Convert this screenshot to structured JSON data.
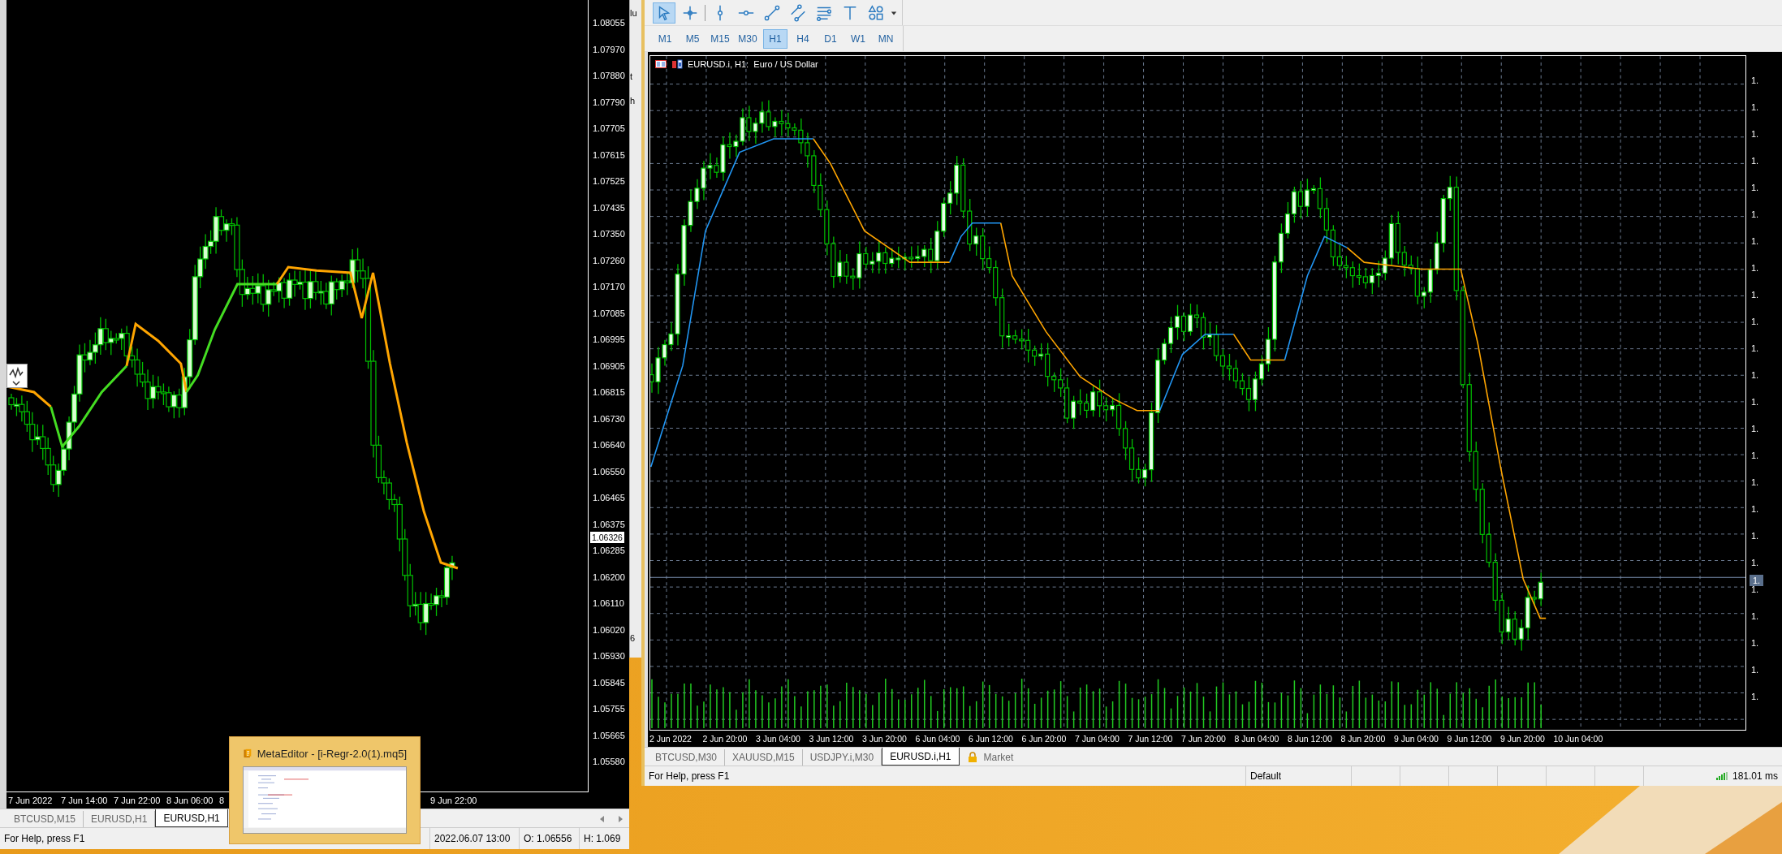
{
  "left_window": {
    "price_axis": [
      "1.08055",
      "1.07970",
      "1.07880",
      "1.07790",
      "1.07705",
      "1.07615",
      "1.07525",
      "1.07435",
      "1.07350",
      "1.07260",
      "1.07170",
      "1.07085",
      "1.06995",
      "1.06905",
      "1.06815",
      "1.06730",
      "1.06640",
      "1.06550",
      "1.06465",
      "1.06375",
      "1.06285",
      "1.06200",
      "1.06110",
      "1.06020",
      "1.05930",
      "1.05845",
      "1.05755",
      "1.05665",
      "1.05580"
    ],
    "current_price": "1.06326",
    "time_axis": [
      "7 Jun 2022",
      "7 Jun 14:00",
      "7 Jun 22:00",
      "8 Jun 06:00",
      "8",
      "9 Jun 22:00"
    ],
    "tabs": [
      {
        "label": "BTCUSD,M15",
        "selected": false
      },
      {
        "label": "EURUSD,H1",
        "selected": false
      },
      {
        "label": "EURUSD,H1",
        "selected": true
      }
    ],
    "status_bar": [
      "For Help, press F1",
      "2022.06.07 13:00",
      "O: 1.06556",
      "H: 1.069"
    ]
  },
  "background_window": {
    "fragments": [
      "lu",
      "t",
      "h",
      "6"
    ]
  },
  "right_window": {
    "tools": [
      {
        "kind": "cursor",
        "selected": true
      },
      {
        "kind": "crosshair",
        "selected": false
      },
      {
        "kind": "vertical-line",
        "selected": false
      },
      {
        "kind": "horizontal-line",
        "selected": false
      },
      {
        "kind": "trendline",
        "selected": false
      },
      {
        "kind": "channel",
        "selected": false
      },
      {
        "kind": "fibonacci",
        "selected": false
      },
      {
        "kind": "text",
        "selected": false
      },
      {
        "kind": "shapes",
        "selected": false
      }
    ],
    "timeframes": [
      {
        "label": "M1",
        "selected": false
      },
      {
        "label": "M5",
        "selected": false
      },
      {
        "label": "M15",
        "selected": false
      },
      {
        "label": "M30",
        "selected": false
      },
      {
        "label": "H1",
        "selected": true
      },
      {
        "label": "H4",
        "selected": false
      },
      {
        "label": "D1",
        "selected": false
      },
      {
        "label": "W1",
        "selected": false
      },
      {
        "label": "MN",
        "selected": false
      }
    ],
    "chart_title": "EURUSD.i, H1:  Euro / US Dollar",
    "price_axis": [
      "1.",
      "1.",
      "1.",
      "1.",
      "1.",
      "1.",
      "1.",
      "1.",
      "1.",
      "1.",
      "1.",
      "1.",
      "1.",
      "1.",
      "1.",
      "1.",
      "1.",
      "1.",
      "1.",
      "1.",
      "1.",
      "1.",
      "1.",
      "1."
    ],
    "current_price": "1.",
    "time_axis": [
      "2 Jun 2022",
      "2 Jun 20:00",
      "3 Jun 04:00",
      "3 Jun 12:00",
      "3 Jun 20:00",
      "6 Jun 04:00",
      "6 Jun 12:00",
      "6 Jun 20:00",
      "7 Jun 04:00",
      "7 Jun 12:00",
      "7 Jun 20:00",
      "8 Jun 04:00",
      "8 Jun 12:00",
      "8 Jun 20:00",
      "9 Jun 04:00",
      "9 Jun 12:00",
      "9 Jun 20:00",
      "10 Jun 04:00"
    ],
    "tabs": [
      {
        "label": "BTCUSD,M30",
        "kind": "chart",
        "selected": false
      },
      {
        "label": "XAUUSD,M15",
        "kind": "chart",
        "selected": false
      },
      {
        "label": "USDJPY.i,M30",
        "kind": "chart",
        "selected": false
      },
      {
        "label": "EURUSD.i,H1",
        "kind": "chart",
        "selected": true
      },
      {
        "label": "Market",
        "kind": "market",
        "selected": false
      }
    ],
    "status_bar": {
      "help": "For Help, press F1",
      "profile": "Default",
      "ping": "181.01 ms"
    }
  },
  "taskbar_preview": {
    "title": "MetaEditor - [i-Regr-2.0(1).mq5]"
  }
}
